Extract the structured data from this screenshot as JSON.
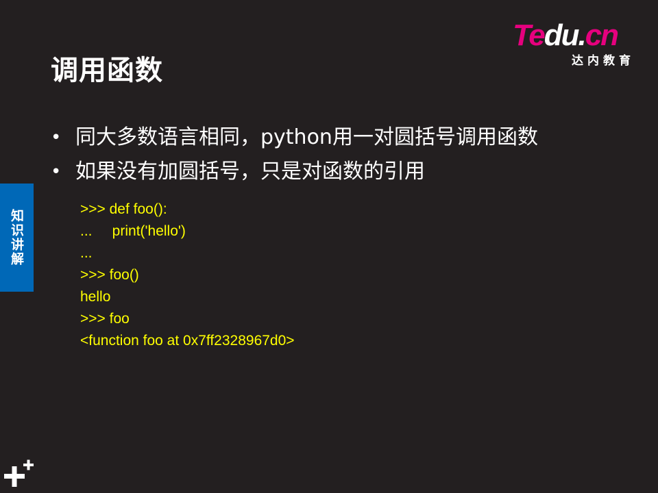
{
  "slide": {
    "title": "调用函数",
    "bullets": [
      "同大多数语言相同，python用一对圆括号调用函数",
      "如果没有加圆括号，只是对函数的引用"
    ],
    "code_lines": [
      ">>> def foo():",
      "...     print('hello')",
      "...",
      ">>> foo()",
      "hello",
      ">>> foo",
      "<function foo at 0x7ff2328967d0>"
    ]
  },
  "logo": {
    "te": "Te",
    "du": "du.",
    "cn": "cn",
    "subtitle": "达内教育"
  },
  "side_tab": {
    "label": "知识讲解"
  },
  "colors": {
    "background": "#231f20",
    "code": "#ffff00",
    "tab": "#0068b7",
    "brand": "#e6007e"
  }
}
